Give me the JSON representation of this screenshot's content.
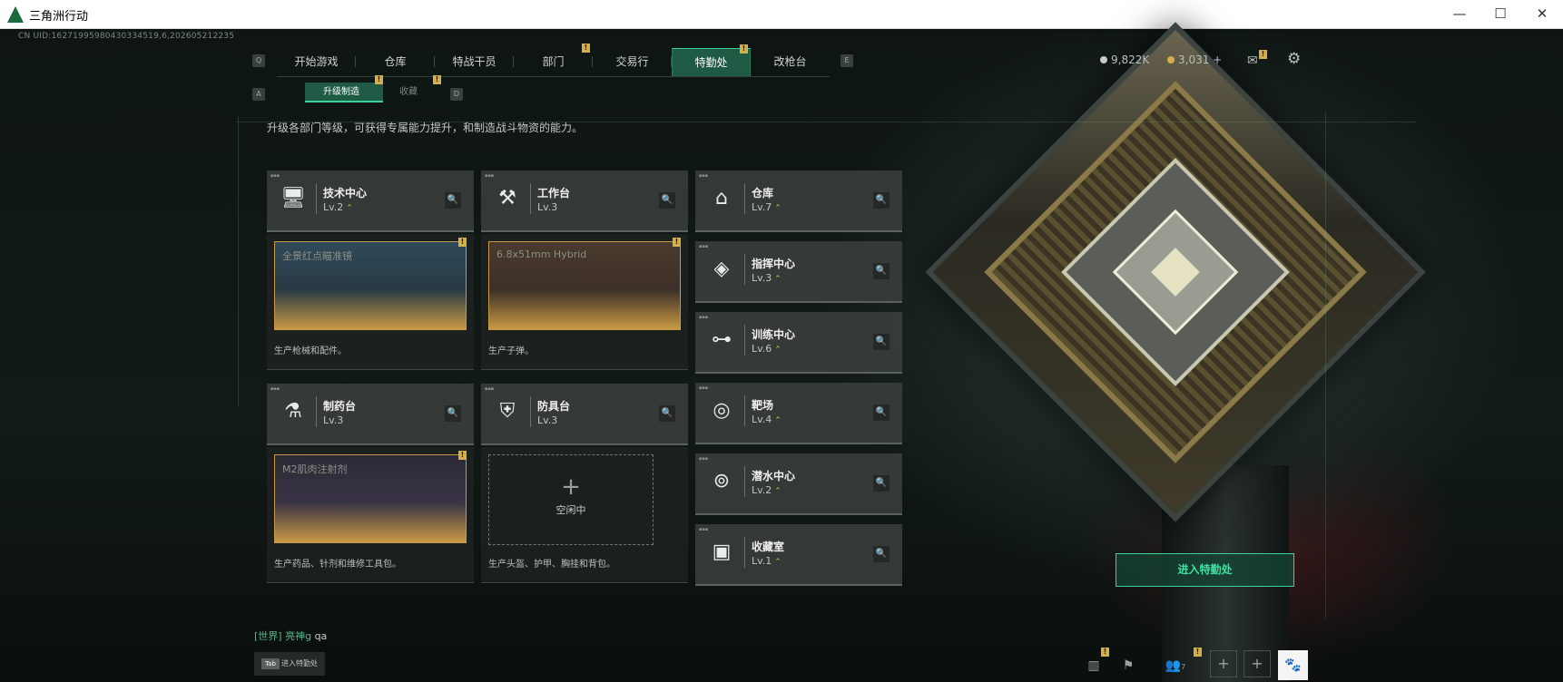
{
  "window": {
    "title": "三角洲行动",
    "min": "—",
    "max": "☐",
    "close": "✕"
  },
  "uid": "CN UID:16271995980430334519,6,202605212235",
  "nav": {
    "left_key": "Q",
    "right_key": "E",
    "tabs": [
      "开始游戏",
      "仓库",
      "特战干员",
      "部门",
      "交易行",
      "特勤处",
      "改枪台"
    ],
    "badge": "!"
  },
  "subnav": {
    "left_key": "A",
    "right_key": "D",
    "tabs": [
      "升级制造",
      "收藏"
    ],
    "badge": "!"
  },
  "resources": {
    "coins": "9,822K",
    "tickets": "3,031 +",
    "badge": "!"
  },
  "description": "升级各部门等级，可获得专属能力提升，和制造战斗物资的能力。",
  "facilities": [
    {
      "name": "技术中心",
      "level": "Lv.2",
      "icon": "monitor-icon",
      "glyph": "🖥",
      "upgrade": "⌃"
    },
    {
      "name": "工作台",
      "level": "Lv.3",
      "icon": "tools-icon",
      "glyph": "⚒",
      "upgrade": ""
    },
    {
      "name": "仓库",
      "level": "Lv.7",
      "icon": "warehouse-icon",
      "glyph": "⌂",
      "upgrade": "⌃"
    },
    {
      "name": "指挥中心",
      "level": "Lv.3",
      "icon": "command-icon",
      "glyph": "◈",
      "upgrade": "⌃"
    },
    {
      "name": "训练中心",
      "level": "Lv.6",
      "icon": "dumbbell-icon",
      "glyph": "⊶",
      "upgrade": "⌃"
    },
    {
      "name": "制药台",
      "level": "Lv.3",
      "icon": "microscope-icon",
      "glyph": "⚗",
      "upgrade": ""
    },
    {
      "name": "防具台",
      "level": "Lv.3",
      "icon": "armor-icon",
      "glyph": "⛨",
      "upgrade": ""
    },
    {
      "name": "靶场",
      "level": "Lv.4",
      "icon": "target-icon",
      "glyph": "◎",
      "upgrade": "⌃"
    },
    {
      "name": "潜水中心",
      "level": "Lv.2",
      "icon": "diving-mask-icon",
      "glyph": "⊚",
      "upgrade": "⌃"
    },
    {
      "name": "收藏室",
      "level": "Lv.1",
      "icon": "vault-icon",
      "glyph": "▣",
      "upgrade": "⌃"
    }
  ],
  "production": [
    {
      "item": "全景红点瞄准镜",
      "desc": "生产枪械和配件。",
      "badge": "!"
    },
    {
      "item": "6.8x51mm Hybrid",
      "desc": "生产子弹。",
      "badge": "!"
    },
    {
      "item": "M2肌肉注射剂",
      "desc": "生产药品、针剂和维修工具包。",
      "badge": "!"
    },
    {
      "item": "",
      "desc": "生产头盔、护甲、胸挂和背包。",
      "badge": ""
    }
  ],
  "idle": {
    "plus": "+",
    "text": "空闲中"
  },
  "enter_button": "进入特勤处",
  "chat": {
    "channel": "[世界]",
    "user": "亮神g",
    "message": "qa"
  },
  "tab_hint": {
    "key": "Tab",
    "label": "进入特勤处"
  },
  "bottom": {
    "badge": "!",
    "friends": "7",
    "plus": "+"
  },
  "colors": {
    "accent": "#3fd19a",
    "active_tab": "#1f5a45",
    "badge": "#d4b04a",
    "upgrade": "#d9b84d"
  }
}
